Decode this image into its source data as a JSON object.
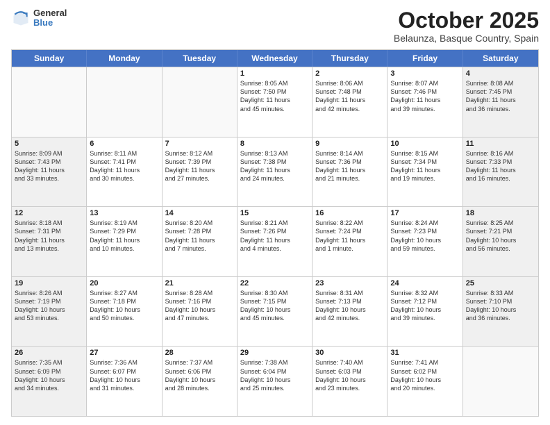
{
  "logo": {
    "general": "General",
    "blue": "Blue"
  },
  "header": {
    "month": "October 2025",
    "location": "Belaunza, Basque Country, Spain"
  },
  "weekdays": [
    "Sunday",
    "Monday",
    "Tuesday",
    "Wednesday",
    "Thursday",
    "Friday",
    "Saturday"
  ],
  "rows": [
    [
      {
        "day": "",
        "lines": [],
        "empty": true
      },
      {
        "day": "",
        "lines": [],
        "empty": true
      },
      {
        "day": "",
        "lines": [],
        "empty": true
      },
      {
        "day": "1",
        "lines": [
          "Sunrise: 8:05 AM",
          "Sunset: 7:50 PM",
          "Daylight: 11 hours",
          "and 45 minutes."
        ]
      },
      {
        "day": "2",
        "lines": [
          "Sunrise: 8:06 AM",
          "Sunset: 7:48 PM",
          "Daylight: 11 hours",
          "and 42 minutes."
        ]
      },
      {
        "day": "3",
        "lines": [
          "Sunrise: 8:07 AM",
          "Sunset: 7:46 PM",
          "Daylight: 11 hours",
          "and 39 minutes."
        ]
      },
      {
        "day": "4",
        "lines": [
          "Sunrise: 8:08 AM",
          "Sunset: 7:45 PM",
          "Daylight: 11 hours",
          "and 36 minutes."
        ],
        "shaded": true
      }
    ],
    [
      {
        "day": "5",
        "lines": [
          "Sunrise: 8:09 AM",
          "Sunset: 7:43 PM",
          "Daylight: 11 hours",
          "and 33 minutes."
        ],
        "shaded": true
      },
      {
        "day": "6",
        "lines": [
          "Sunrise: 8:11 AM",
          "Sunset: 7:41 PM",
          "Daylight: 11 hours",
          "and 30 minutes."
        ]
      },
      {
        "day": "7",
        "lines": [
          "Sunrise: 8:12 AM",
          "Sunset: 7:39 PM",
          "Daylight: 11 hours",
          "and 27 minutes."
        ]
      },
      {
        "day": "8",
        "lines": [
          "Sunrise: 8:13 AM",
          "Sunset: 7:38 PM",
          "Daylight: 11 hours",
          "and 24 minutes."
        ]
      },
      {
        "day": "9",
        "lines": [
          "Sunrise: 8:14 AM",
          "Sunset: 7:36 PM",
          "Daylight: 11 hours",
          "and 21 minutes."
        ]
      },
      {
        "day": "10",
        "lines": [
          "Sunrise: 8:15 AM",
          "Sunset: 7:34 PM",
          "Daylight: 11 hours",
          "and 19 minutes."
        ]
      },
      {
        "day": "11",
        "lines": [
          "Sunrise: 8:16 AM",
          "Sunset: 7:33 PM",
          "Daylight: 11 hours",
          "and 16 minutes."
        ],
        "shaded": true
      }
    ],
    [
      {
        "day": "12",
        "lines": [
          "Sunrise: 8:18 AM",
          "Sunset: 7:31 PM",
          "Daylight: 11 hours",
          "and 13 minutes."
        ],
        "shaded": true
      },
      {
        "day": "13",
        "lines": [
          "Sunrise: 8:19 AM",
          "Sunset: 7:29 PM",
          "Daylight: 11 hours",
          "and 10 minutes."
        ]
      },
      {
        "day": "14",
        "lines": [
          "Sunrise: 8:20 AM",
          "Sunset: 7:28 PM",
          "Daylight: 11 hours",
          "and 7 minutes."
        ]
      },
      {
        "day": "15",
        "lines": [
          "Sunrise: 8:21 AM",
          "Sunset: 7:26 PM",
          "Daylight: 11 hours",
          "and 4 minutes."
        ]
      },
      {
        "day": "16",
        "lines": [
          "Sunrise: 8:22 AM",
          "Sunset: 7:24 PM",
          "Daylight: 11 hours",
          "and 1 minute."
        ]
      },
      {
        "day": "17",
        "lines": [
          "Sunrise: 8:24 AM",
          "Sunset: 7:23 PM",
          "Daylight: 10 hours",
          "and 59 minutes."
        ]
      },
      {
        "day": "18",
        "lines": [
          "Sunrise: 8:25 AM",
          "Sunset: 7:21 PM",
          "Daylight: 10 hours",
          "and 56 minutes."
        ],
        "shaded": true
      }
    ],
    [
      {
        "day": "19",
        "lines": [
          "Sunrise: 8:26 AM",
          "Sunset: 7:19 PM",
          "Daylight: 10 hours",
          "and 53 minutes."
        ],
        "shaded": true
      },
      {
        "day": "20",
        "lines": [
          "Sunrise: 8:27 AM",
          "Sunset: 7:18 PM",
          "Daylight: 10 hours",
          "and 50 minutes."
        ]
      },
      {
        "day": "21",
        "lines": [
          "Sunrise: 8:28 AM",
          "Sunset: 7:16 PM",
          "Daylight: 10 hours",
          "and 47 minutes."
        ]
      },
      {
        "day": "22",
        "lines": [
          "Sunrise: 8:30 AM",
          "Sunset: 7:15 PM",
          "Daylight: 10 hours",
          "and 45 minutes."
        ]
      },
      {
        "day": "23",
        "lines": [
          "Sunrise: 8:31 AM",
          "Sunset: 7:13 PM",
          "Daylight: 10 hours",
          "and 42 minutes."
        ]
      },
      {
        "day": "24",
        "lines": [
          "Sunrise: 8:32 AM",
          "Sunset: 7:12 PM",
          "Daylight: 10 hours",
          "and 39 minutes."
        ]
      },
      {
        "day": "25",
        "lines": [
          "Sunrise: 8:33 AM",
          "Sunset: 7:10 PM",
          "Daylight: 10 hours",
          "and 36 minutes."
        ],
        "shaded": true
      }
    ],
    [
      {
        "day": "26",
        "lines": [
          "Sunrise: 7:35 AM",
          "Sunset: 6:09 PM",
          "Daylight: 10 hours",
          "and 34 minutes."
        ],
        "shaded": true
      },
      {
        "day": "27",
        "lines": [
          "Sunrise: 7:36 AM",
          "Sunset: 6:07 PM",
          "Daylight: 10 hours",
          "and 31 minutes."
        ]
      },
      {
        "day": "28",
        "lines": [
          "Sunrise: 7:37 AM",
          "Sunset: 6:06 PM",
          "Daylight: 10 hours",
          "and 28 minutes."
        ]
      },
      {
        "day": "29",
        "lines": [
          "Sunrise: 7:38 AM",
          "Sunset: 6:04 PM",
          "Daylight: 10 hours",
          "and 25 minutes."
        ]
      },
      {
        "day": "30",
        "lines": [
          "Sunrise: 7:40 AM",
          "Sunset: 6:03 PM",
          "Daylight: 10 hours",
          "and 23 minutes."
        ]
      },
      {
        "day": "31",
        "lines": [
          "Sunrise: 7:41 AM",
          "Sunset: 6:02 PM",
          "Daylight: 10 hours",
          "and 20 minutes."
        ]
      },
      {
        "day": "",
        "lines": [],
        "empty": true,
        "shaded": true
      }
    ]
  ]
}
